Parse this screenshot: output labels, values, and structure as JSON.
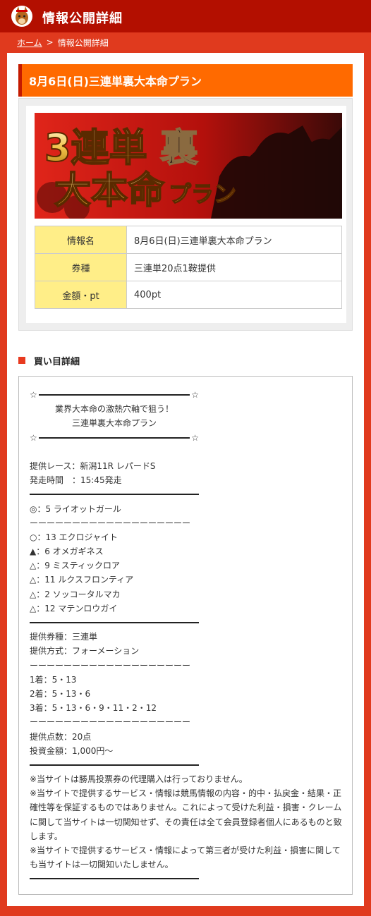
{
  "header": {
    "title": "情報公開詳細"
  },
  "breadcrumb": {
    "home": "ホーム",
    "separator": ">",
    "current": "情報公開詳細"
  },
  "plan": {
    "title": "8月6日(日)三連単裏大本命プラン",
    "banner": {
      "line1": "3連単",
      "line1_accent": "裏",
      "line2": "大本命",
      "line2_small": "プラン"
    },
    "table": [
      {
        "key": "情報名",
        "value": "8月6日(日)三連単裏大本命プラン"
      },
      {
        "key": "券種",
        "value": "三連単20点1鞍提供"
      },
      {
        "key": "金額・pt",
        "value": "400pt"
      }
    ]
  },
  "section": {
    "title": "買い目詳細"
  },
  "detail": {
    "star": "☆",
    "headline1": "業界大本命の激熱穴軸で狙う！",
    "headline2": "三連単裏大本命プラン",
    "race": "提供レース：新潟11R レパードS",
    "time": "発走時間　：15:45発走",
    "dashes": "ーーーーーーーーーーーーーーーーーーー",
    "picks": [
      "◎：5 ライオットガール",
      "○：13 エクロジャイト",
      "▲：6 オメガギネス",
      "△：9 ミスティックロア",
      "△：11 ルクスフロンティア",
      "△：2 ソッコータルマカ",
      "△：12 マテンロウガイ"
    ],
    "ticket_type": "提供券種：三連単",
    "ticket_method": "提供方式：フォーメーション",
    "first": "1着：5・13",
    "second": "2着：5・13・6",
    "third": "3着：5・13・6・9・11・2・12",
    "points": "提供点数：20点",
    "investment": "投資金額：1,000円～",
    "notes": [
      "※当サイトは勝馬投票券の代理購入は行っておりません。",
      "※当サイトで提供するサービス・情報は競馬情報の内容・的中・払戻金・結果・正確性等を保証するものではありません。これによって受けた利益・損害・クレームに関して当サイトは一切関知せず、その責任は全て会員登録者個人にあるものと致します。",
      "※当サイトで提供するサービス・情報によって第三者が受けた利益・損害に関しても当サイトは一切関知いたしません。"
    ]
  }
}
